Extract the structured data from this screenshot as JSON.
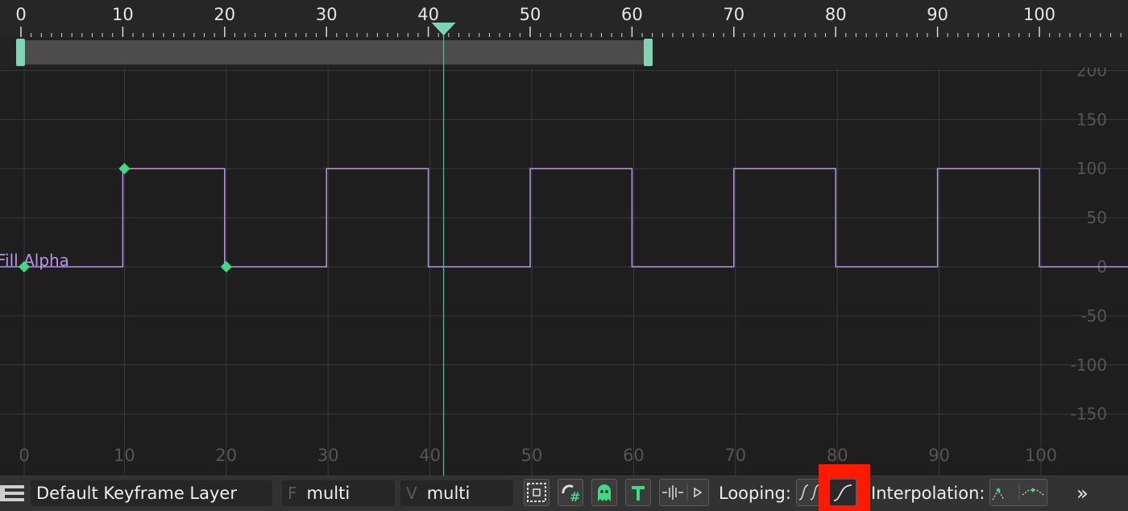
{
  "ruler": {
    "ticks": [
      "0",
      "10",
      "20",
      "30",
      "40",
      "50",
      "60",
      "70",
      "80",
      "90",
      "100"
    ]
  },
  "playhead": {
    "frame": 41.5
  },
  "play_range": {
    "start": 0,
    "end": 61.5
  },
  "graph": {
    "x_labels": [
      "0",
      "10",
      "20",
      "30",
      "40",
      "50",
      "60",
      "70",
      "80",
      "90",
      "100"
    ],
    "y_labels": [
      "200",
      "150",
      "100",
      "50",
      "0",
      "-50",
      "-100",
      "-150"
    ],
    "y_values": [
      200,
      150,
      100,
      50,
      0,
      -50,
      -100,
      -150
    ],
    "curve_label": "Fill Alpha",
    "curve_color": "#b794e8",
    "keyframe_color": "#3ddc84",
    "keyframes": [
      {
        "frame": 0,
        "value": 0
      },
      {
        "frame": 10,
        "value": 100
      },
      {
        "frame": 20,
        "value": 0
      }
    ],
    "looped_value": "square wave 0/100, period 20 frames"
  },
  "toolbar": {
    "layer_menu_icon": "list-icon",
    "layer_name": "Default Keyframe Layer",
    "frame_prefix": "F",
    "frame_value": "multi",
    "value_prefix": "V",
    "value_value": "multi",
    "tools": [
      "frame-selection-icon",
      "snap-grid-icon",
      "ghost-icon",
      "text-icon",
      "split-icon",
      "play-icon"
    ],
    "looping_label": "Looping:",
    "interpolation_label": "Interpolation:",
    "more_label": "»",
    "accent": "#3ddc84"
  }
}
